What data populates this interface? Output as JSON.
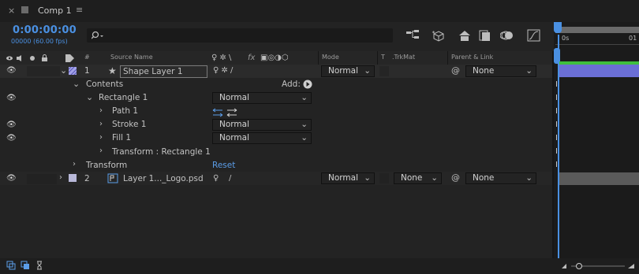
{
  "tab": {
    "title": "Comp 1",
    "close": "×",
    "menu": "≡"
  },
  "time": {
    "timecode": "0:00:00:00",
    "frames": "00000 (60.00 fps)"
  },
  "search": {
    "placeholder": ""
  },
  "timeline": {
    "label_start": "0s",
    "label_end": "01"
  },
  "columns": {
    "label_hash": "#",
    "source_name": "Source Name",
    "fx": "fx",
    "mode": "Mode",
    "t": "T",
    "trkmat": ".TrkMat",
    "parent": "Parent & Link"
  },
  "layers": [
    {
      "num": "1",
      "name": "Shape Layer 1",
      "mode": "Normal",
      "parent": "None",
      "color": "#a4a3e8",
      "bar_color": "#6b6fd6"
    },
    {
      "num": "2",
      "name": "Layer 1..._Logo.psd",
      "mode": "Normal",
      "trkmat": "None",
      "parent": "None",
      "color": "#b8b8d8",
      "bar_color": "#5a5a5a"
    }
  ],
  "contents": {
    "label": "Contents",
    "add_label": "Add:",
    "rectangle": {
      "label": "Rectangle 1",
      "mode": "Normal"
    },
    "path": {
      "label": "Path 1"
    },
    "stroke": {
      "label": "Stroke 1",
      "mode": "Normal"
    },
    "fill": {
      "label": "Fill 1",
      "mode": "Normal"
    },
    "transform_rect": {
      "label": "Transform : Rectangle 1"
    }
  },
  "transform": {
    "label": "Transform",
    "reset": "Reset"
  },
  "colors": {
    "accent": "#4a90e2",
    "timeline_green": "#3fbf3f"
  }
}
